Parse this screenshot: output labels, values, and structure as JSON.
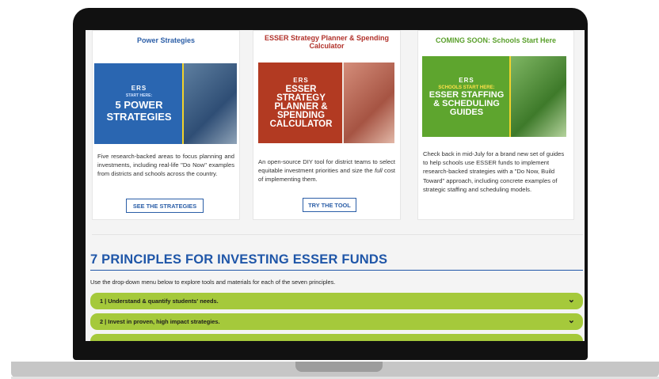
{
  "cards": [
    {
      "title": "Power Strategies",
      "image": {
        "logo": "ERS",
        "kicker": "START HERE:",
        "line1": "5 POWER",
        "line2": "STRATEGIES",
        "line3": "",
        "line4": ""
      },
      "description": "Five research-backed areas to focus planning and investments, including real-life \"Do Now\" examples from districts and schools across the country.",
      "button_label": "SEE THE STRATEGIES"
    },
    {
      "title": "ESSER Strategy Planner & Spending Calculator",
      "image": {
        "logo": "ERS",
        "kicker": "",
        "line1": "ESSER",
        "line2": "STRATEGY",
        "line3": "PLANNER &",
        "line4": "SPENDING",
        "line5": "CALCULATOR"
      },
      "description_before": "An open-source DIY tool for district teams to select equitable investment priorities and size the ",
      "description_em": "full",
      "description_after": " cost of implementing them.",
      "button_label": "TRY THE TOOL"
    },
    {
      "title": "COMING SOON: Schools Start Here",
      "image": {
        "logo": "ERS",
        "kicker": "SCHOOLS START HERE:",
        "line1": "ESSER STAFFING",
        "line2": "& SCHEDULING",
        "line3": "GUIDES"
      },
      "description": "Check back in mid-July for a brand new set of guides to help schools use ESSER funds to implement research-backed strategies with a \"Do Now, Build Toward\" approach, including concrete examples of strategic staffing and scheduling models."
    }
  ],
  "section": {
    "title": "7 PRINCIPLES FOR INVESTING ESSER FUNDS",
    "intro": "Use the drop-down menu below to explore tools and materials for each of the seven principles."
  },
  "principles": [
    {
      "number": "1 |",
      "label": "Understand & quantify students' needs."
    },
    {
      "number": "2 |",
      "label": "Invest in proven, high impact strategies."
    }
  ],
  "icons": {
    "accordion": "chevron-down-icon"
  },
  "colors": {
    "blue": "#1f56a8",
    "red": "#b1312a",
    "green": "#5aa02c",
    "accordion": "#a5c93b"
  }
}
